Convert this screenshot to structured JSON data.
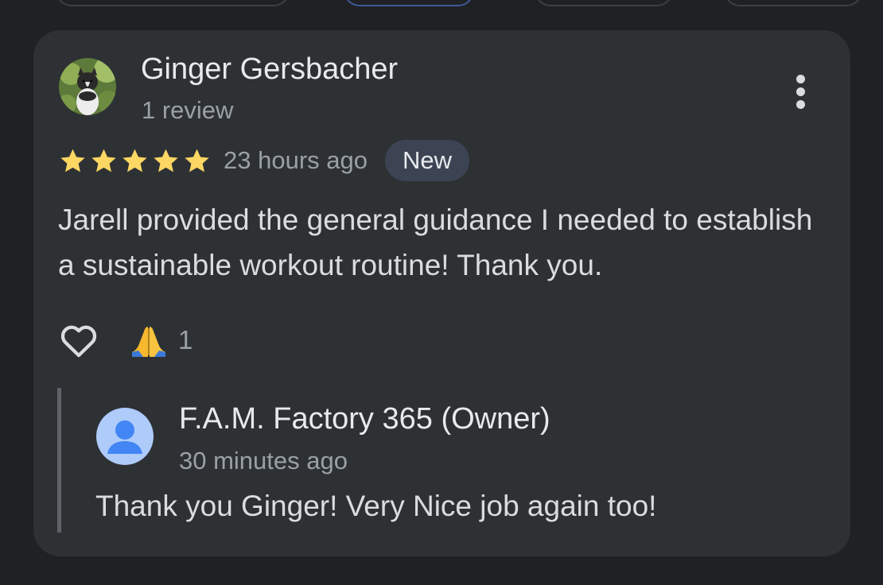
{
  "review": {
    "reviewer_name": "Ginger Gersbacher",
    "review_count": "1 review",
    "rating": 5,
    "rating_max": 5,
    "time_ago": "23 hours ago",
    "badge": "New",
    "text": "Jarell provided the general guidance I needed to establish a sustainable workout routine! Thank you.",
    "reactions": {
      "like_icon": "heart-outline-icon",
      "emoji_icon": "folded-hands-emoji",
      "count": "1"
    }
  },
  "reply": {
    "owner_name": "F.A.M. Factory 365 (Owner)",
    "time_ago": "30 minutes ago",
    "text": "Thank you Ginger! Very Nice job again too!"
  },
  "colors": {
    "background": "#202124",
    "card": "#2e3134",
    "star": "#fdd663",
    "badge_bg": "#3c4454",
    "owner_avatar": "#aecbfa"
  }
}
